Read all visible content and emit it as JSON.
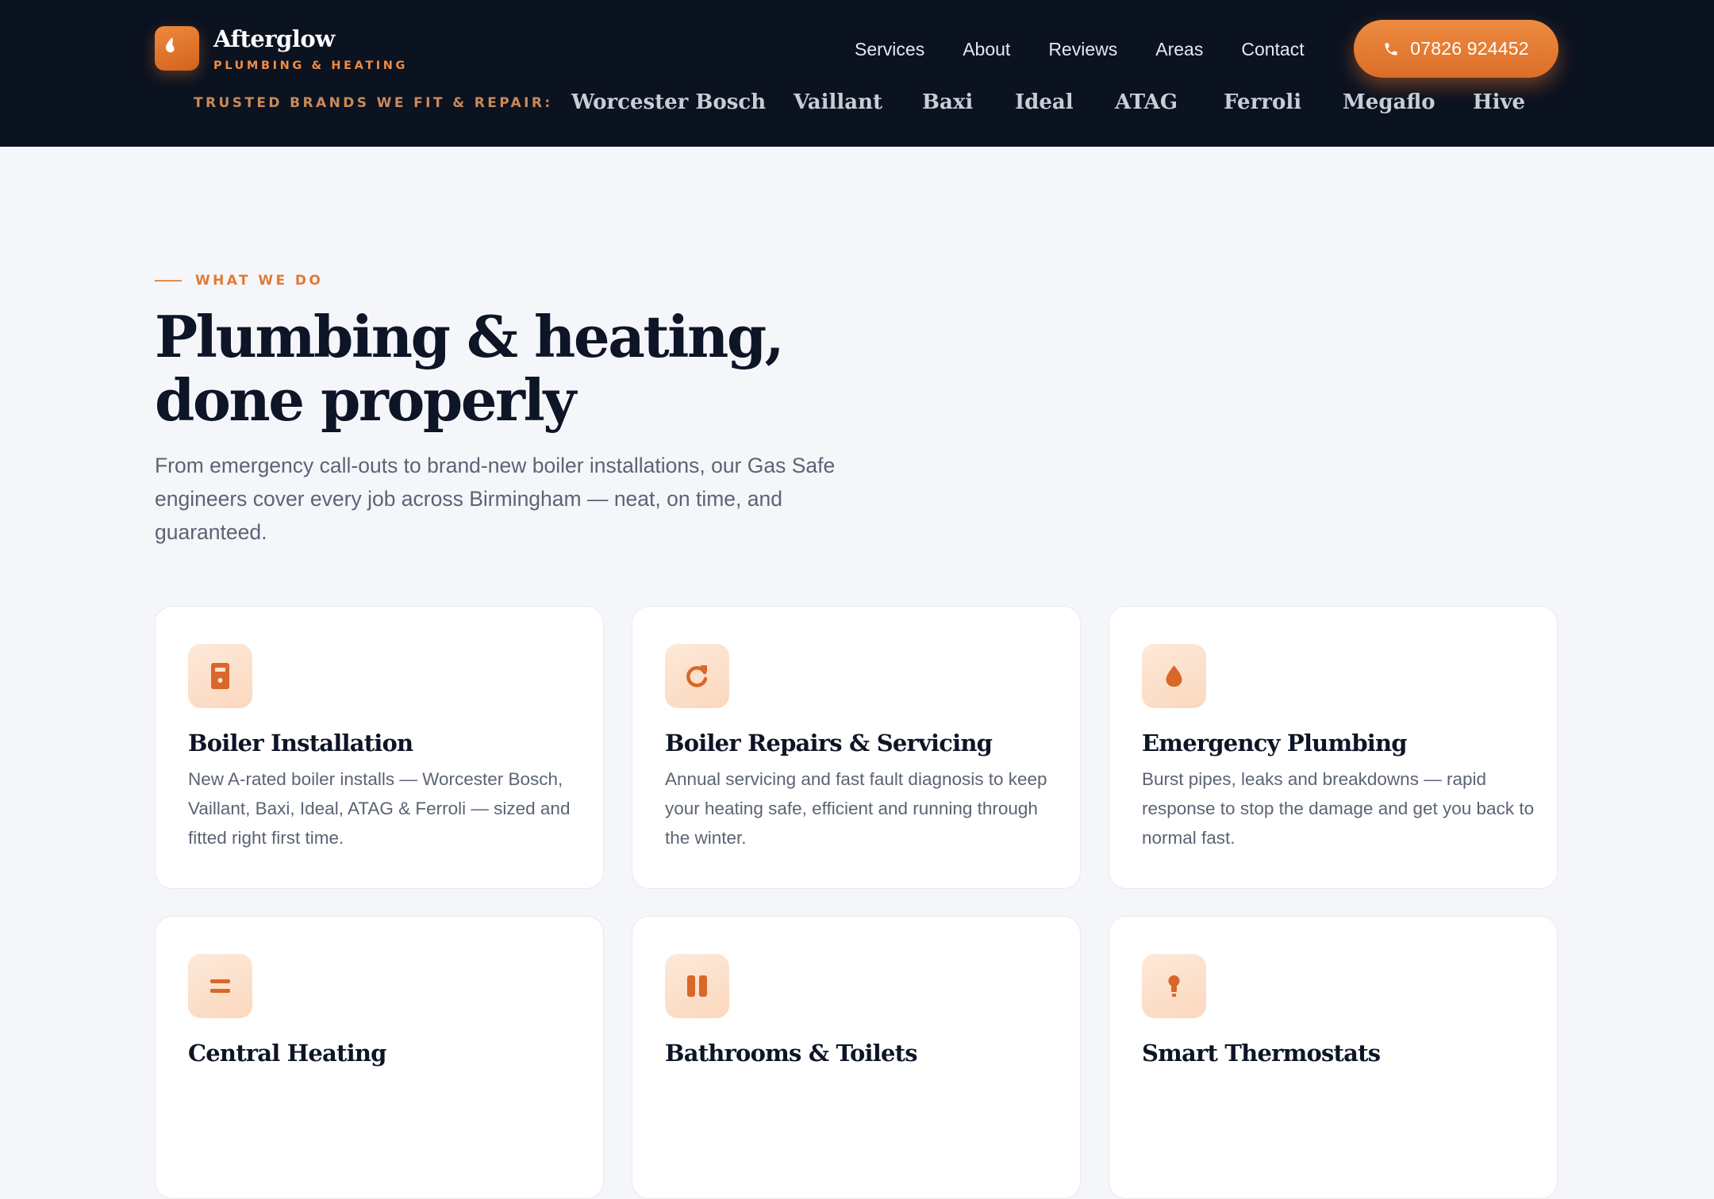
{
  "header": {
    "brand_name": "Afterglow",
    "brand_tagline": "PLUMBING & HEATING",
    "nav": [
      "Services",
      "About",
      "Reviews",
      "Areas",
      "Contact"
    ],
    "phone": "07826 924452",
    "brands_label": "TRUSTED BRANDS WE FIT & REPAIR:",
    "brands": [
      "Worcester Bosch",
      "Vaillant",
      "Baxi",
      "Ideal",
      "ATAG",
      "Ferroli",
      "Megaflo",
      "Hive"
    ]
  },
  "services": {
    "eyebrow": "WHAT WE DO",
    "title": "Plumbing & heating, done properly",
    "description": "From emergency call-outs to brand-new boiler installations, our Gas Safe engineers cover every job across Birmingham — neat, on time, and guaranteed.",
    "cards": [
      {
        "icon": "boiler-icon",
        "title": "Boiler Installation",
        "description": "New A-rated boiler installs — Worcester Bosch, Vaillant, Baxi, Ideal, ATAG & Ferroli — sized and fitted right first time."
      },
      {
        "icon": "refresh-icon",
        "title": "Boiler Repairs & Servicing",
        "description": "Annual servicing and fast fault diagnosis to keep your heating safe, efficient and running through the winter."
      },
      {
        "icon": "water-drop-icon",
        "title": "Emergency Plumbing",
        "description": "Burst pipes, leaks and breakdowns — rapid response to stop the damage and get you back to normal fast."
      },
      {
        "icon": "radiator-icon",
        "title": "Central Heating",
        "description": ""
      },
      {
        "icon": "bath-icon",
        "title": "Bathrooms & Toilets",
        "description": ""
      },
      {
        "icon": "thermostat-icon",
        "title": "Smart Thermostats",
        "description": ""
      }
    ]
  },
  "colors": {
    "accent": "#e07a35",
    "header_bg": "#0b1220",
    "page_bg": "#f5f6fa",
    "heading": "#0d1526",
    "body_text": "#5b6474"
  }
}
